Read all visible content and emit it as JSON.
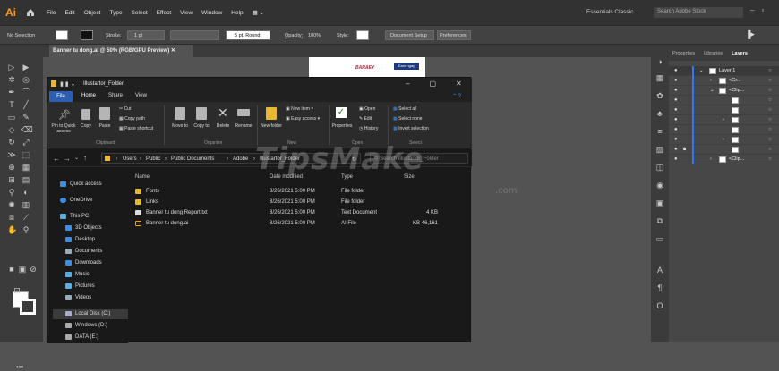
{
  "app": {
    "logo": "Ai",
    "menus": [
      "File",
      "Edit",
      "Object",
      "Type",
      "Select",
      "Effect",
      "View",
      "Window",
      "Help"
    ],
    "workspace": "Essentials Classic",
    "search_placeholder": "Search Adobe Stock"
  },
  "control_bar": {
    "selection": "No Selection",
    "stroke_label": "Stroke:",
    "stroke_value": "1 pt",
    "brush": "5 pt. Round",
    "opacity_label": "Opacity:",
    "opacity_value": "100%",
    "style_label": "Style:",
    "doc_setup": "Document Setup",
    "preferences": "Preferences"
  },
  "document_tab": "Banner tu dong.ai @ 50% (RGB/GPU Preview)",
  "artboard": {
    "logo_text": "BARAEY",
    "button_text": "Earn ngay"
  },
  "layers_panel": {
    "tabs": [
      "Properties",
      "Libraries",
      "Layers"
    ],
    "active_tab": "Layers",
    "rows": [
      {
        "name": "Layer 1"
      },
      {
        "name": "<Gr..."
      },
      {
        "name": "<Clip..."
      },
      {
        "name": ""
      },
      {
        "name": ""
      },
      {
        "name": ""
      },
      {
        "name": ""
      },
      {
        "name": ""
      },
      {
        "name": ""
      },
      {
        "name": "<Clip..."
      }
    ]
  },
  "explorer": {
    "title": "Illustartor_Folder",
    "tabs": [
      "File",
      "Home",
      "Share",
      "View"
    ],
    "ribbon": {
      "pin": "Pin to Quick access",
      "copy": "Copy",
      "paste": "Paste",
      "cut": "Cut",
      "copy_path": "Copy path",
      "paste_shortcut": "Paste shortcut",
      "move_to": "Move to",
      "copy_to": "Copy to",
      "delete": "Delete",
      "rename": "Rename",
      "new_folder": "New folder",
      "new_item": "New item",
      "easy_access": "Easy access",
      "properties": "Properties",
      "open": "Open",
      "edit": "Edit",
      "history": "History",
      "select_all": "Select all",
      "select_none": "Select none",
      "invert_selection": "Invert selection",
      "groups": [
        "Clipboard",
        "Organize",
        "New",
        "Open",
        "Select"
      ]
    },
    "breadcrumb": [
      "Users",
      "Public",
      "Public Documents",
      "Adobe",
      "Illustartor_Folder"
    ],
    "search_placeholder": "Search Illustartor_Folder",
    "nav": [
      "Quick access",
      "OneDrive",
      "This PC",
      "3D Objects",
      "Desktop",
      "Documents",
      "Downloads",
      "Music",
      "Pictures",
      "Videos",
      "Local Disk (C:)",
      "Windows (D:)",
      "DATA (E:)"
    ],
    "columns": [
      "Name",
      "Date modified",
      "Type",
      "Size"
    ],
    "files": [
      {
        "name": "Fonts",
        "date": "8/26/2021 5:00 PM",
        "type": "File folder",
        "size": ""
      },
      {
        "name": "Links",
        "date": "8/26/2021 5:00 PM",
        "type": "File folder",
        "size": ""
      },
      {
        "name": "Banner tu dong Report.txt",
        "date": "8/26/2021 5:00 PM",
        "type": "Text Document",
        "size": "4 KB"
      },
      {
        "name": "Banner tu dong.ai",
        "date": "8/26/2021 5:00 PM",
        "type": "AI File",
        "size": "46,161 KB"
      }
    ]
  },
  "watermark": {
    "main": "TipsMake",
    "suffix": ".com"
  }
}
